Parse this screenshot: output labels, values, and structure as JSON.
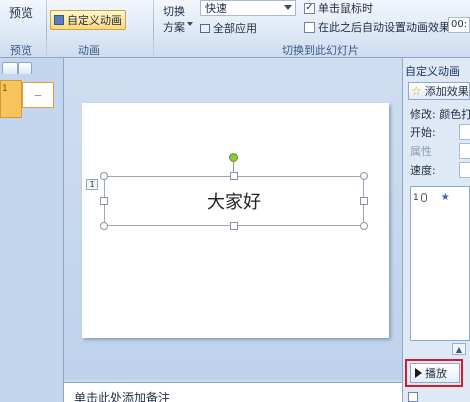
{
  "ribbon": {
    "preview_label": "预览",
    "preview_group": "预览",
    "custom_anim_label": "自定义动画",
    "animation_group": "动画",
    "switch_label_line1": "切换",
    "switch_label_line2": "方案",
    "speed_value": "快速",
    "apply_all_label": "全部应用",
    "on_click_label": "单击鼠标时",
    "auto_after_label": "在此之后自动设置动画效果:",
    "auto_time_value": "00:",
    "switch_group": "切换到此幻灯片"
  },
  "thumbnails": {
    "slide_number": "1",
    "slide_text": "—"
  },
  "slide": {
    "main_text": "大家好",
    "anim_tag": "1"
  },
  "notes": {
    "placeholder": "单击此处添加备注"
  },
  "task_pane": {
    "title": "自定义动画",
    "add_effect_label": "添加效果",
    "modify_label": "修改: 颜色打",
    "start_label": "开始:",
    "property_label": "属性",
    "speed_label": "速度:",
    "list_item_number": "1",
    "play_label": "播放"
  }
}
